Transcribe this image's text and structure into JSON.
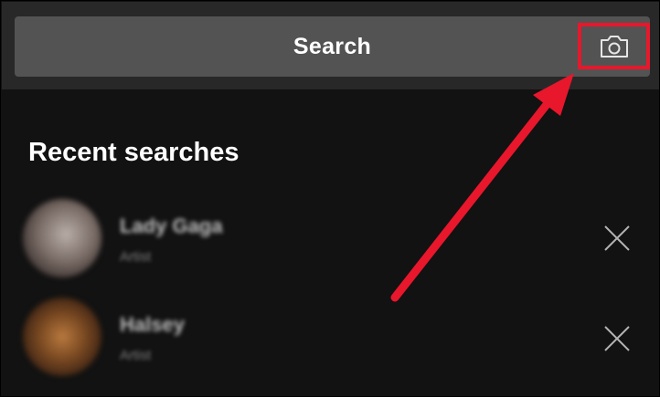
{
  "search": {
    "label": "Search"
  },
  "recent": {
    "title": "Recent searches",
    "items": [
      {
        "name": "Lady Gaga",
        "type": "Artist"
      },
      {
        "name": "Halsey",
        "type": "Artist"
      }
    ]
  },
  "colors": {
    "background": "#121212",
    "header": "#282828",
    "search_bar": "#535353",
    "highlight": "#e8172c"
  },
  "icons": {
    "camera": "camera-icon",
    "remove": "close-icon"
  }
}
